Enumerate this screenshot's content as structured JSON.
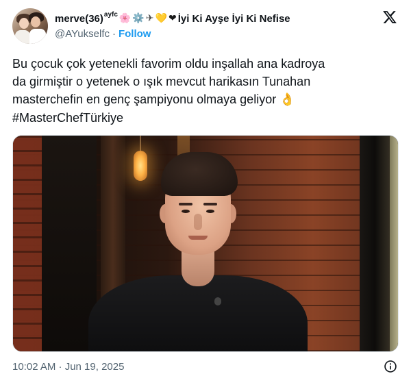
{
  "author": {
    "display_name": "merve(36)",
    "name_superscript": "ayfc",
    "name_emojis": [
      "🌸",
      "⚙️",
      "✈",
      "💛",
      "❤"
    ],
    "name_tail": "İyi Ki Ayşe İyi Ki Nefise",
    "handle": "@AYukselfc",
    "separator": "·",
    "follow_label": "Follow",
    "avatar_icon": "avatar-photo"
  },
  "platform_icon": "x-logo-icon",
  "tweet": {
    "lines": [
      "Bu çocuk çok yetenekli favorim oldu inşallah ana kadroya",
      "da girmiştir o yetenek o ışık mevcut harikasın Tunahan",
      "masterchefin en genç şampiyonu olmaya geliyor "
    ],
    "ok_emoji": "👌",
    "hashtag": "#MasterChefTürkiye"
  },
  "media": {
    "type": "photo"
  },
  "footer": {
    "timestamp": "10:02 AM · Jun 19, 2025",
    "info_icon": "info-icon"
  },
  "colors": {
    "text_primary": "#0f1419",
    "text_secondary": "#536471",
    "link": "#1d9bf0",
    "background": "#ffffff"
  }
}
